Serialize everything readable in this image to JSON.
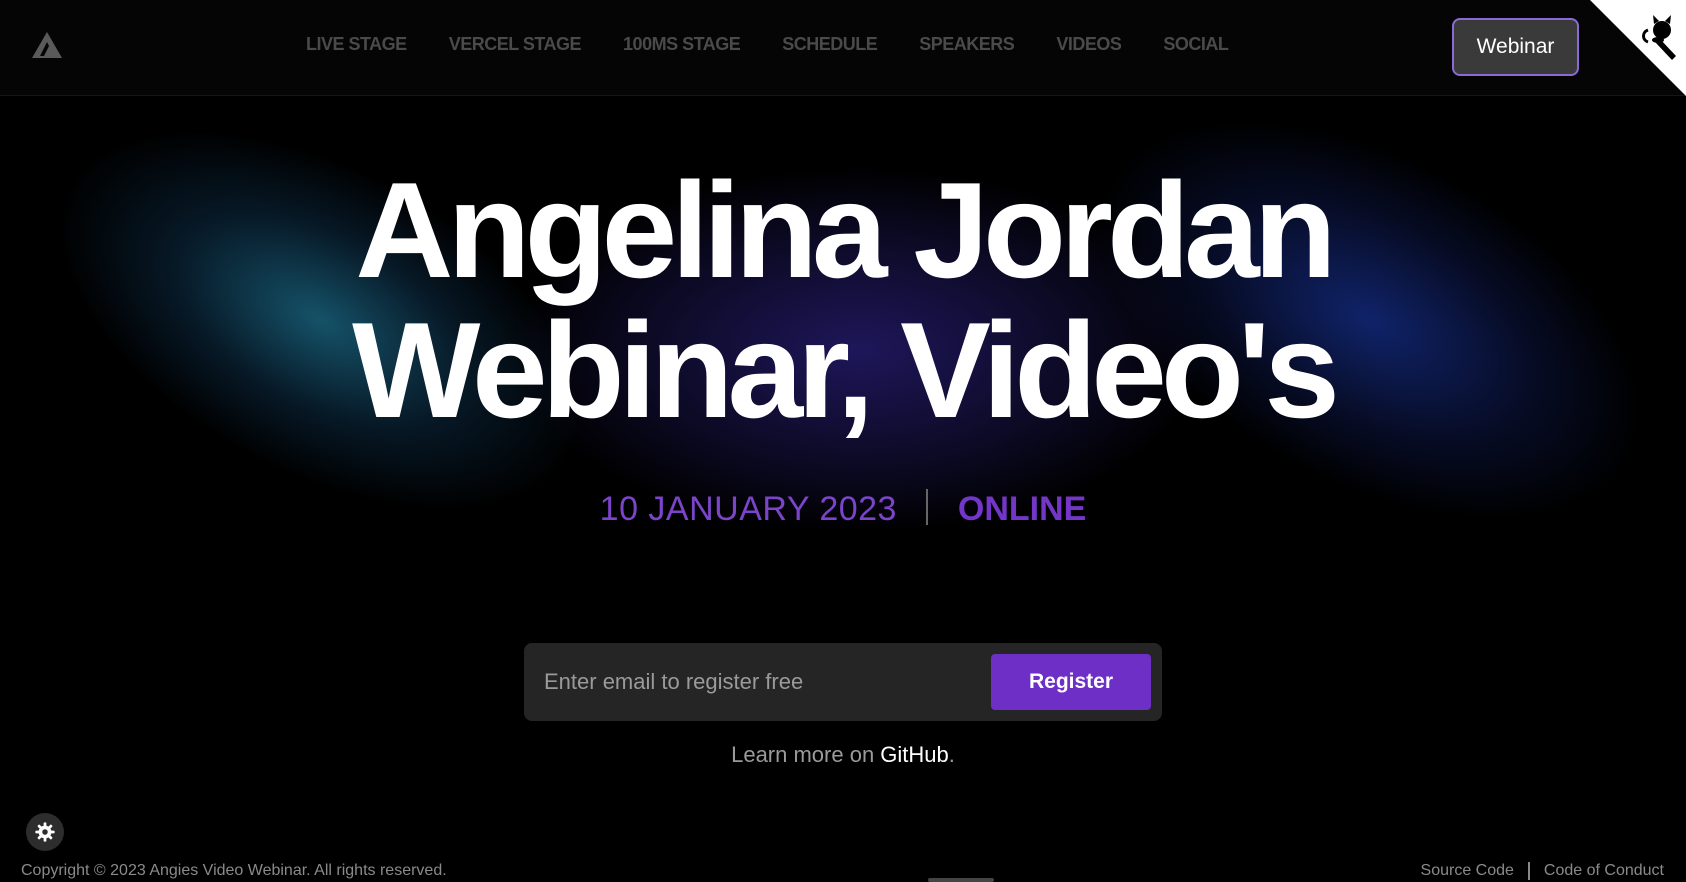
{
  "header": {
    "logo_icon": "triangle-logo-icon",
    "nav": [
      {
        "label": "LIVE STAGE"
      },
      {
        "label": "VERCEL STAGE"
      },
      {
        "label": "100MS STAGE"
      },
      {
        "label": "SCHEDULE"
      },
      {
        "label": "SPEAKERS"
      },
      {
        "label": "VIDEOS"
      },
      {
        "label": "SOCIAL"
      }
    ],
    "webinar_button": "Webinar",
    "corner_icon": "github-octocat-icon"
  },
  "hero": {
    "title_line1": "Angelina Jordan",
    "title_line2": "Webinar, Video's",
    "date": "10 JANUARY 2023",
    "location": "ONLINE"
  },
  "register": {
    "placeholder": "Enter email to register free",
    "button": "Register",
    "learn_prefix": "Learn more on ",
    "learn_link": "GitHub",
    "learn_suffix": "."
  },
  "settings_icon": "gear-icon",
  "footer": {
    "copyright": "Copyright © 2023 Angies Video Webinar. All rights reserved.",
    "source_code": "Source Code",
    "code_of_conduct": "Code of Conduct"
  },
  "colors": {
    "accent": "#6d2fc6",
    "date": "#7b44c9",
    "nav": "#4a4a4a",
    "webinar_border": "#8b6ad8"
  }
}
